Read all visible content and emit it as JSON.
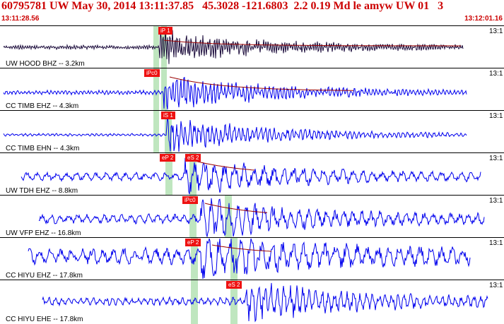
{
  "header": {
    "title": "60795781 UW May 30, 2014 13:11:37.85   45.3028 -121.6803  2.2 0.19 Md le amyw UW 01   3",
    "start_time": "13:11:28.56",
    "end_time": "13:12:01.16"
  },
  "tick_label": "13:1",
  "colors": {
    "header_text": "#cc0000",
    "trace_dark": "#1a0a3a",
    "trace_blue": "#0000ee",
    "pick_red": "#ee1111",
    "band_green": "#bfe6bf",
    "coda_line": "#990000"
  },
  "traces": [
    {
      "label": "UW HOOD BHZ -- 3.2km",
      "picks": [
        "iP 1"
      ]
    },
    {
      "label": "CC TIMB EHZ -- 4.3km",
      "picks": [
        "iPc0"
      ]
    },
    {
      "label": "CC TIMB EHN -- 4.3km",
      "picks": [
        "iS 1"
      ]
    },
    {
      "label": "UW TDH EHZ -- 8.8km",
      "picks": [
        "eP 2",
        "eS 2"
      ]
    },
    {
      "label": "UW VFP EHZ -- 16.8km",
      "picks": [
        "iPc0"
      ]
    },
    {
      "label": "CC HIYU EHZ -- 17.8km",
      "picks": [
        "eP 2"
      ]
    },
    {
      "label": "CC HIYU EHE -- 17.8km",
      "picks": [
        "eS 2"
      ]
    }
  ]
}
